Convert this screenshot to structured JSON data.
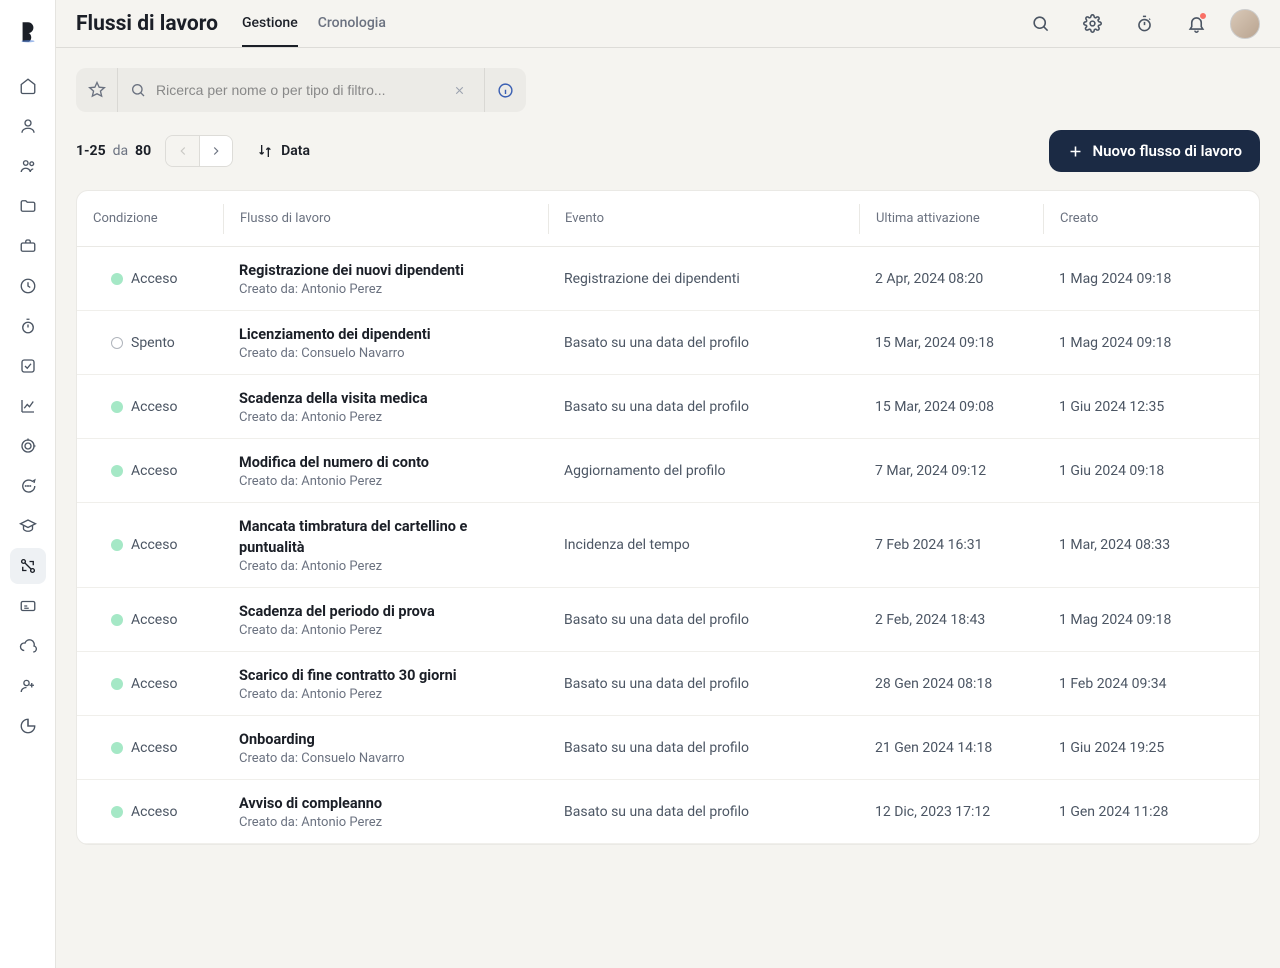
{
  "header": {
    "title": "Flussi di lavoro",
    "tabs": [
      {
        "label": "Gestione",
        "active": true
      },
      {
        "label": "Cronologia",
        "active": false
      }
    ]
  },
  "search": {
    "placeholder": "Ricerca per nome o per tipo di filtro..."
  },
  "toolbar": {
    "range": "1-25",
    "of_label": "da",
    "total": "80",
    "sort_label": "Data",
    "new_button": "Nuovo flusso di lavoro"
  },
  "status_labels": {
    "on": "Acceso",
    "off": "Spento"
  },
  "table": {
    "headers": {
      "condition": "Condizione",
      "workflow": "Flusso di lavoro",
      "event": "Evento",
      "last": "Ultima attivazione",
      "created": "Creato"
    },
    "created_prefix": "Creato da:",
    "rows": [
      {
        "status": "on",
        "title": "Registrazione dei nuovi dipendenti",
        "creator": "Antonio Perez",
        "event": "Registrazione dei dipendenti",
        "last": "2 Apr, 2024 08:20",
        "created": "1 Mag 2024 09:18"
      },
      {
        "status": "off",
        "title": "Licenziamento dei dipendenti",
        "creator": "Consuelo Navarro",
        "event": "Basato su una data del profilo",
        "last": "15 Mar, 2024 09:18",
        "created": "1 Mag 2024 09:18"
      },
      {
        "status": "on",
        "title": "Scadenza della visita medica",
        "creator": "Antonio Perez",
        "event": "Basato su una data del profilo",
        "last": "15 Mar, 2024 09:08",
        "created": "1 Giu 2024 12:35"
      },
      {
        "status": "on",
        "title": "Modifica del numero di conto",
        "creator": "Antonio Perez",
        "event": "Aggiornamento del profilo",
        "last": "7 Mar, 2024 09:12",
        "created": "1 Giu 2024 09:18"
      },
      {
        "status": "on",
        "title": "Mancata timbratura del cartellino e puntualità",
        "creator": "Antonio Perez",
        "event": "Incidenza del tempo",
        "last": "7 Feb 2024 16:31",
        "created": "1 Mar, 2024 08:33"
      },
      {
        "status": "on",
        "title": "Scadenza del periodo di prova",
        "creator": "Antonio Perez",
        "event": "Basato su una data del profilo",
        "last": "2 Feb, 2024 18:43",
        "created": "1 Mag 2024 09:18"
      },
      {
        "status": "on",
        "title": "Scarico di fine contratto 30 giorni",
        "creator": "Antonio Perez",
        "event": "Basato su una data del profilo",
        "last": "28 Gen 2024 08:18",
        "created": "1 Feb 2024 09:34"
      },
      {
        "status": "on",
        "title": "Onboarding",
        "creator": "Consuelo Navarro",
        "event": "Basato su una data del profilo",
        "last": "21 Gen 2024 14:18",
        "created": "1 Giu 2024 19:25"
      },
      {
        "status": "on",
        "title": "Avviso di compleanno",
        "creator": "Antonio Perez",
        "event": "Basato su una data del profilo",
        "last": "12 Dic, 2023 17:12",
        "created": "1 Gen 2024 11:28"
      }
    ]
  }
}
